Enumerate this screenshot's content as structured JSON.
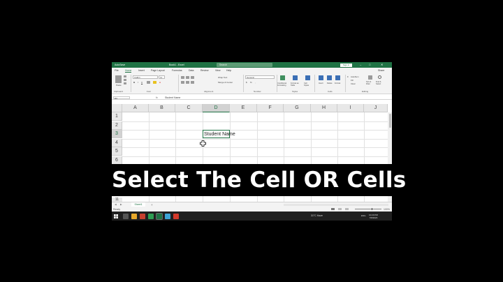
{
  "titlebar": {
    "autosave": "AutoSave",
    "title": "Book1 - Excel",
    "search": "Search",
    "signin": "Sign in"
  },
  "menu": {
    "tabs": [
      "File",
      "Home",
      "Insert",
      "Page Layout",
      "Formulas",
      "Data",
      "Review",
      "View",
      "Help"
    ],
    "active": "Home",
    "share": "Share"
  },
  "ribbon": {
    "clipboard_label": "Clipboard",
    "font_label": "Font",
    "alignment_label": "Alignment",
    "number_label": "Number",
    "styles_label": "Styles",
    "cells_label": "Cells",
    "editing_label": "Editing",
    "font_name": "Calibri",
    "font_size": "11",
    "number_format": "General",
    "wrap_text": "Wrap Text",
    "merge_center": "Merge & Center",
    "paste": "Paste",
    "conditional_formatting": "Conditional Formatting",
    "format_as_table": "Format as Table",
    "cell_styles": "Cell Styles",
    "insert": "Insert",
    "delete": "Delete",
    "format": "Format",
    "autosum": "AutoSum",
    "fill": "Fill",
    "clear": "Clear",
    "sort_filter": "Sort & Filter",
    "find_select": "Find & Select"
  },
  "formula_bar": {
    "name_box": "D3",
    "fx": "fx",
    "content": "Student Name"
  },
  "grid": {
    "columns": [
      "A",
      "B",
      "C",
      "D",
      "E",
      "F",
      "G",
      "H",
      "I",
      "J"
    ],
    "selected_column": "D",
    "rows": [
      "1",
      "2",
      "3",
      "4",
      "5",
      "6"
    ],
    "selected_row": "3",
    "active_cell": {
      "ref": "D3",
      "value": "Student Name"
    },
    "partial_row": "11"
  },
  "sheets": {
    "tabs": [
      "Sheet1"
    ],
    "add": "+"
  },
  "status": {
    "ready": "Ready",
    "zoom": "100%"
  },
  "taskbar": {
    "weather": "31°C Haze",
    "lang": "ENG",
    "time": "10:20 PM",
    "date": "7/8/2023"
  },
  "overlay": {
    "caption": "Select The Cell OR Cells"
  },
  "colors": {
    "excel_green": "#1f7244",
    "taskbar": "#202020",
    "caption_bg": "#000000",
    "caption_text": "#ffffff"
  }
}
